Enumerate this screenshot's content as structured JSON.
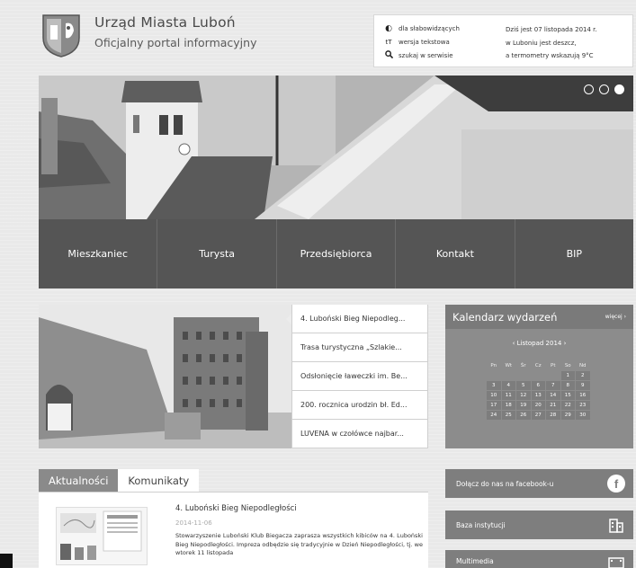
{
  "header": {
    "title": "Urząd Miasta Luboń",
    "subtitle": "Oficjalny portal informacyjny"
  },
  "tools": [
    {
      "icon": "contrast-icon",
      "label": "dla słabowidzących"
    },
    {
      "icon": "text-version-icon",
      "label": "wersja tekstowa"
    },
    {
      "icon": "search-icon",
      "label": "szukaj w serwisie"
    }
  ],
  "weather": {
    "line1": "Dziś jest 07 listopada 2014 r.",
    "line2": "w Luboniu jest deszcz,",
    "line3": "a termometry wskazują 9°C"
  },
  "nav": {
    "items": [
      "Mieszkaniec",
      "Turysta",
      "Przedsiębiorca",
      "Kontakt",
      "BIP"
    ]
  },
  "features": {
    "items": [
      "4. Luboński Bieg Niepodleg...",
      "Trasa turystyczna „Szlakie...",
      "Odsłonięcie ławeczki im. Be...",
      "200. rocznica urodzin bł. Ed...",
      "LUVENA w czołówce najbar..."
    ]
  },
  "calendar": {
    "title": "Kalendarz wydarzeń",
    "more": "więcej ›",
    "month": "‹  Listopad 2014  ›",
    "dow": [
      "Pn",
      "Wt",
      "Śr",
      "Cz",
      "Pt",
      "So",
      "Nd"
    ],
    "days": [
      "",
      "",
      "",
      "",
      "",
      "1",
      "2",
      "3",
      "4",
      "5",
      "6",
      "7",
      "8",
      "9",
      "10",
      "11",
      "12",
      "13",
      "14",
      "15",
      "16",
      "17",
      "18",
      "19",
      "20",
      "21",
      "22",
      "23",
      "24",
      "25",
      "26",
      "27",
      "28",
      "29",
      "30"
    ]
  },
  "news": {
    "tabs": [
      "Aktualności",
      "Komunikaty"
    ],
    "title": "4. Luboński Bieg Niepodległości",
    "date": "2014-11-06",
    "body": "Stowarzyszenie Luboński Klub Biegacza zaprasza wszystkich kibiców na 4. Luboński Bieg Niepodległości. Impreza odbędzie się tradycyjnie w Dzień Niepodległości, tj. we wtorek 11 listopada"
  },
  "side": {
    "facebook": "Dołącz do nas na facebook-u",
    "institutions": "Baza instytucji",
    "multimedia": "Multimedia"
  },
  "colors": {
    "nav_bg": "#555555",
    "calendar_bg": "#8c8c8c",
    "side_btn_bg": "#7e7e7e",
    "tab_active": "#8a8a8a"
  }
}
